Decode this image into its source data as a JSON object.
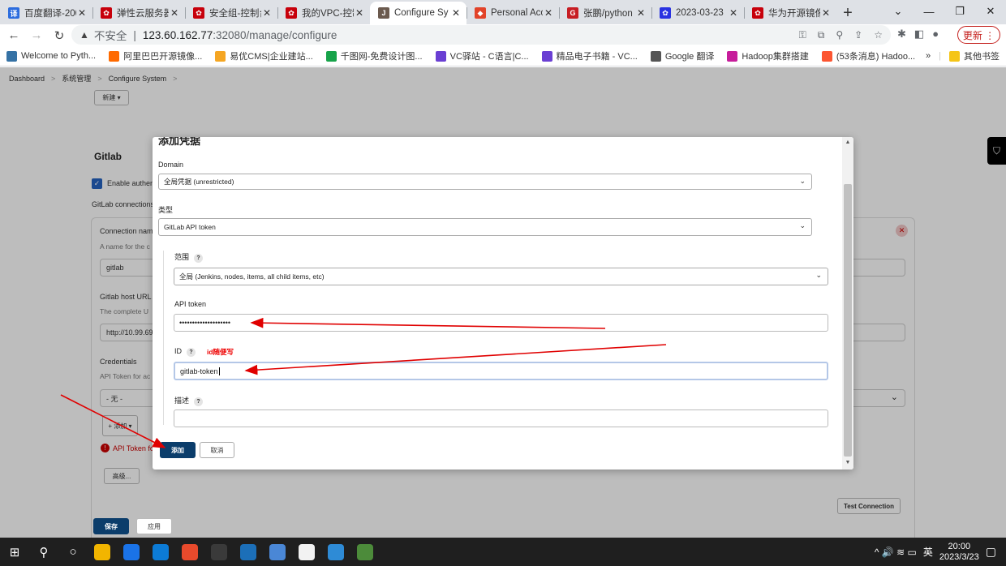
{
  "browser": {
    "tabs": [
      {
        "title": "百度翻译-200",
        "favicon_color": "#2b6cde",
        "favicon_glyph": "译"
      },
      {
        "title": "弹性云服务器",
        "favicon_color": "#c7000b",
        "favicon_glyph": "✿"
      },
      {
        "title": "安全组-控制台",
        "favicon_color": "#c7000b",
        "favicon_glyph": "✿"
      },
      {
        "title": "我的VPC-控制",
        "favicon_color": "#c7000b",
        "favicon_glyph": "✿"
      },
      {
        "title": "Configure Sy",
        "favicon_color": "#6b5a4e",
        "favicon_glyph": "J",
        "active": true
      },
      {
        "title": "Personal Acc",
        "favicon_color": "#e24329",
        "favicon_glyph": "◆"
      },
      {
        "title": "张鹏/python",
        "favicon_color": "#c71d23",
        "favicon_glyph": "G"
      },
      {
        "title": "2023-03-23",
        "favicon_color": "#2932e1",
        "favicon_glyph": "✿"
      },
      {
        "title": "华为开源镜像",
        "favicon_color": "#c7000b",
        "favicon_glyph": "✿"
      }
    ],
    "tab_close": "✕",
    "new_tab": "+",
    "window_controls": [
      "⌄",
      "—",
      "❐",
      "✕"
    ],
    "nav": {
      "back": "←",
      "forward": "→",
      "reload": "↻"
    },
    "address": {
      "warning_icon": "▲",
      "security": "不安全",
      "separator": "|",
      "host": "123.60.162.77",
      "path": ":32080/manage/configure"
    },
    "omni_icons": [
      "⚿",
      "⧉",
      "⚲",
      "⇪",
      "☆"
    ],
    "toolbar_icons": [
      "✱",
      "◧",
      "●"
    ],
    "update_label": "更新  ⋮",
    "bookmarks": [
      {
        "label": "Welcome to Pyth...",
        "color": "#3572a5"
      },
      {
        "label": "阿里巴巴开源镜像...",
        "color": "#ff6a00"
      },
      {
        "label": "易优CMS|企业建站...",
        "color": "#f5a623"
      },
      {
        "label": "千图网-免费设计图...",
        "color": "#17a34a"
      },
      {
        "label": "VC驿站 - C语言|C...",
        "color": "#6a3fd3"
      },
      {
        "label": "精品电子书籍 - VC...",
        "color": "#6a3fd3"
      },
      {
        "label": "Google 翻译",
        "color": "#555555"
      },
      {
        "label": "Hadoop集群搭建",
        "color": "#c71d9b"
      },
      {
        "label": "(53条消息) Hadoo...",
        "color": "#fc5531"
      }
    ],
    "bookmarks_more": "»",
    "other_bookmarks": "其他书签"
  },
  "page": {
    "breadcrumb": [
      "Dashboard",
      "系统管理",
      "Configure System"
    ],
    "breadcrumb_sep": ">",
    "new_button": "新建 ▾",
    "section_title": "Gitlab",
    "enable_auth": "Enable authen",
    "gitlab_connections": "GitLab connections",
    "connection_name_label": "Connection nam",
    "connection_name_desc": "A name for the c",
    "connection_name_value": "gitlab",
    "host_url_label": "Gitlab host URL",
    "host_url_desc": "The complete U",
    "host_url_value": "http://10.99.69",
    "credentials_label": "Credentials",
    "credentials_desc": "API Token for ac",
    "credentials_value": "- 无 -",
    "add_cred_button": "+ 添加 ▾",
    "error_text": "API Token fo",
    "advanced_button": "高级...",
    "test_connection": "Test Connection",
    "save_button": "保存",
    "apply_button": "应用",
    "remove_icon": "✕",
    "check_icon": "✓",
    "side_icon": "⛉",
    "select_chevron": "⌄"
  },
  "dialog": {
    "title": "添加凭据",
    "domain_label": "Domain",
    "domain_value": "全局凭据 (unrestricted)",
    "kind_label": "类型",
    "kind_value": "GitLab API token",
    "scope_label": "范围",
    "scope_value": "全局 (Jenkins, nodes, items, all child items, etc)",
    "api_token_label": "API token",
    "api_token_value": "••••••••••••••••••••",
    "id_label": "ID",
    "id_value": "gitlab-token",
    "description_label": "描述",
    "description_value": "",
    "help_mark": "?",
    "chevron": "⌄",
    "add_button": "添加",
    "cancel_button": "取消",
    "annotation": "id随便写",
    "scroll_up": "▲",
    "scroll_down": "▼"
  },
  "annotation_color": "#e00000",
  "taskbar": {
    "start": "⊞",
    "search": "⚲",
    "taskview": "○",
    "apps": [
      {
        "name": "file-explorer",
        "color": "#f2b500"
      },
      {
        "name": "chrome",
        "color": "#1a73e8"
      },
      {
        "name": "edge",
        "color": "#0c7bd6"
      },
      {
        "name": "xshell",
        "color": "#e84a2c"
      },
      {
        "name": "settings",
        "color": "#3a3a3a"
      },
      {
        "name": "vmware",
        "color": "#1c6fb8"
      },
      {
        "name": "notepad",
        "color": "#4a87d6"
      },
      {
        "name": "typora",
        "color": "#f2f2f2"
      },
      {
        "name": "copy-app",
        "color": "#2e8bd6"
      },
      {
        "name": "image-app",
        "color": "#4c8b3a"
      }
    ],
    "tray_icons": "^ 🔊 ≋ ▭",
    "ime": "英",
    "time": "20:00",
    "date": "2023/3/23",
    "notification": "▢"
  }
}
